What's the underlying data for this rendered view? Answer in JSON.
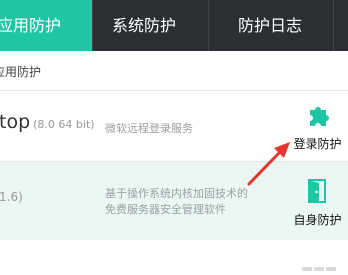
{
  "nav": {
    "tabs": [
      {
        "label": "应用防护",
        "active": true
      },
      {
        "label": "系统防护",
        "active": false
      },
      {
        "label": "防护日志",
        "active": false
      }
    ]
  },
  "section": {
    "label": "应用防护"
  },
  "apps": [
    {
      "name": "top",
      "version": "(8.0 64 bit)",
      "description": "微软远程登录服务",
      "action": {
        "label": "登录防护",
        "icon": "puzzle-icon"
      }
    },
    {
      "name": "",
      "version": "1.6)",
      "description": "基于操作系统内核加固技术的\n免费服务器安全管理软件",
      "action": {
        "label": "自身防护",
        "icon": "door-icon"
      }
    }
  ],
  "colors": {
    "nav_bg": "#2b2f33",
    "accent": "#1ec6a4",
    "annotation_arrow": "#e8352e",
    "alt_row": "#eaf7f3"
  }
}
